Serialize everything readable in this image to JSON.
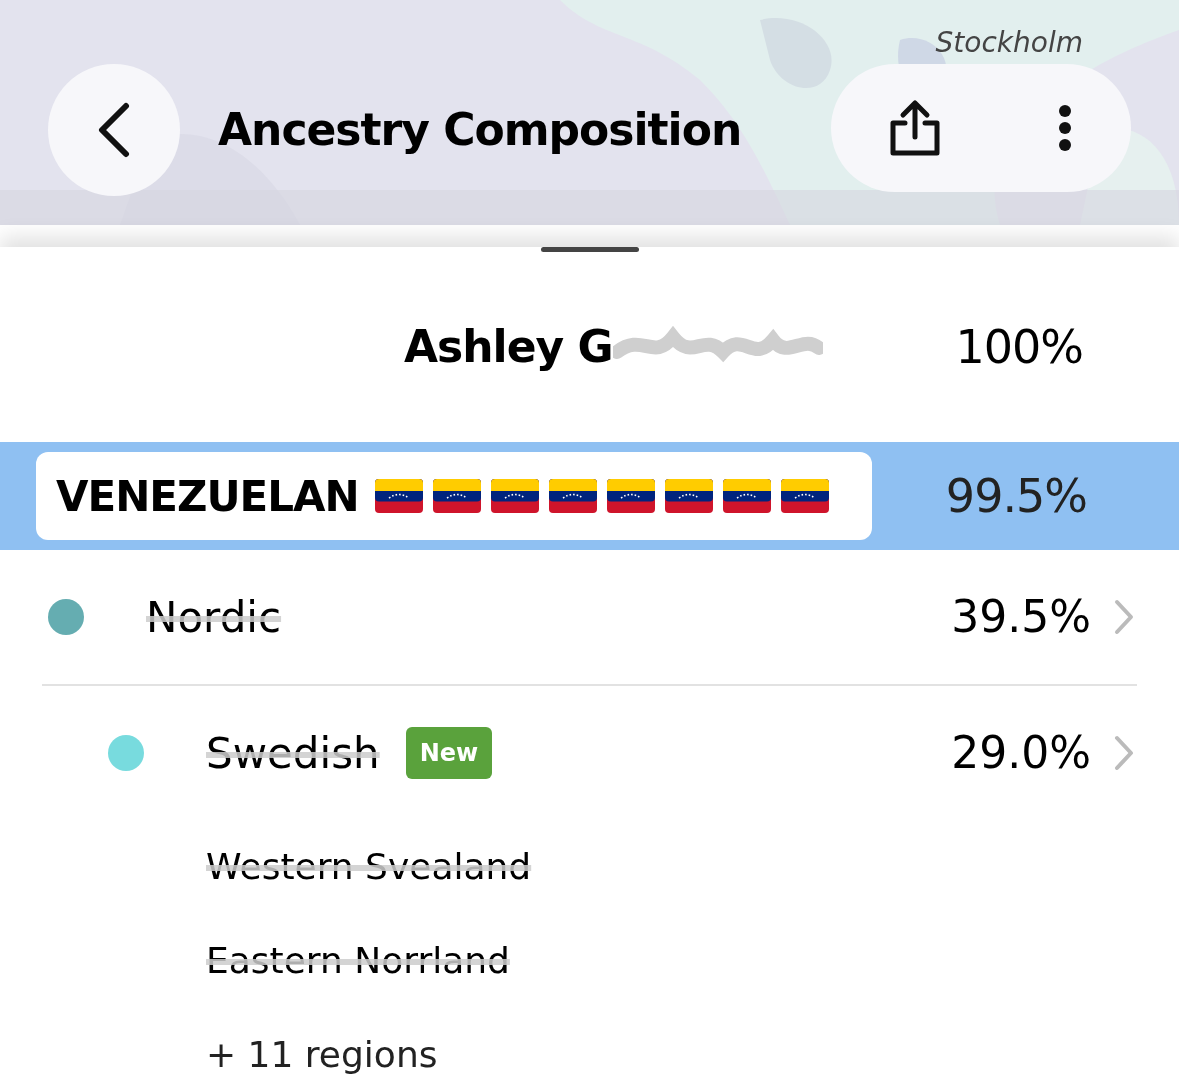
{
  "map": {
    "kind": "picture",
    "city_label": "Stockholm"
  },
  "header": {
    "title": "Ancestry Composition"
  },
  "person": {
    "name": "Ashley G",
    "name_redacted": true,
    "percent": "100%"
  },
  "highlight": {
    "label": "VENEZUELAN",
    "percent": "99.5%",
    "flags": [
      {
        "kind": "flag"
      },
      {
        "kind": "flag"
      },
      {
        "kind": "flag"
      },
      {
        "kind": "flag"
      },
      {
        "kind": "flag"
      },
      {
        "kind": "flag"
      },
      {
        "kind": "flag"
      },
      {
        "kind": "flag"
      }
    ]
  },
  "populations": [
    {
      "name": "Nordic",
      "color": "#65adb1",
      "percent": "39.5%",
      "scribbled": true,
      "children": [
        {
          "name": "Swedish",
          "color": "#78dbde",
          "percent": "29.0%",
          "scribbled": true,
          "badge": "New",
          "regions": [
            {
              "name": "Western Svealand",
              "scribbled": true
            },
            {
              "name": "Eastern Norrland",
              "scribbled": true
            }
          ],
          "more": "+ 11 regions"
        }
      ]
    }
  ]
}
